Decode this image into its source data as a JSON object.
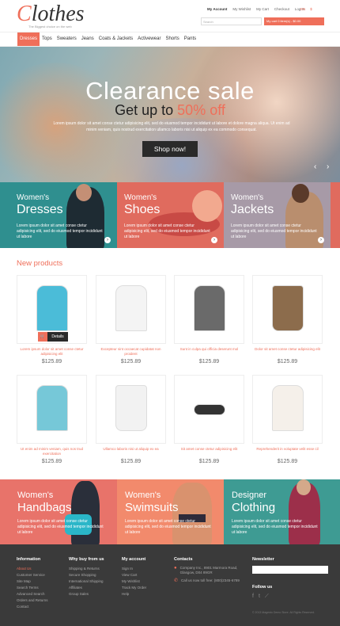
{
  "header": {
    "logo_text": "Clothes",
    "tagline": "The Biggest choice on the web",
    "top_links": [
      "My Account",
      "My Wishlist",
      "My Cart",
      "Checkout",
      "Log In"
    ],
    "lang": "EN",
    "currency": "$",
    "search_placeholder": "Search",
    "cart_label": "My cart  0 item(s) - $0.00"
  },
  "nav": [
    "Dresses",
    "Tops",
    "Sweaters",
    "Jeans",
    "Coats & Jackets",
    "Activewear",
    "Shorts",
    "Pants"
  ],
  "hero": {
    "title": "Clearance sale",
    "subtitle_prefix": "Get up to ",
    "subtitle_pct": "50% off",
    "text": "Lorem ipsum dolor sit amet conse ctetur adipisicing elit, sed do eiusmod tempor incididunt ut labore et dolore magna aliqua. Ut enim ad minim veniam, quis nostrud exercitation ullamco laboris nisi ut aliquip ex ea commodo consequat.",
    "button": "Shop now!",
    "prev": "‹",
    "next": "›"
  },
  "promos": [
    {
      "small": "Women's",
      "big": "Dresses",
      "text": "Lorem ipsum dolor sit amet conse ctetur adipisicing elit, sed do eiusmod tempor incididunt ut labore",
      "color": "#2f8f8f"
    },
    {
      "small": "Women's",
      "big": "Shoes",
      "text": "Lorem ipsum dolor sit amet conse ctetur adipisicing elit, sed do eiusmod tempor incididunt ut labore",
      "color": "#e06b5e"
    },
    {
      "small": "Women's",
      "big": "Jackets",
      "text": "Lorem ipsum dolor sit amet conse ctetur adipisicing elit, sed do eiusmod tempor incididunt ut labore",
      "color": "#a79aa7"
    }
  ],
  "new_products": {
    "heading": "New products",
    "details_label": "Details",
    "items": [
      {
        "name": "Lorem ipsum dolor sit amet conse ctetur adipisicing elit",
        "price": "$125.89",
        "icon": "shirt-icon",
        "color": "#4bbcd8"
      },
      {
        "name": "Excepteur sint occaecat cupidatat non proident",
        "price": "$125.89",
        "icon": "jacket-icon",
        "color": "#f4f4f4"
      },
      {
        "name": "Sunt in culpa qui officia deserunt mol",
        "price": "$125.89",
        "icon": "plaid-shirt-icon",
        "color": "#6a6a6a"
      },
      {
        "name": "Dolor sit amet conse ctetur adipisicing elit",
        "price": "$125.89",
        "icon": "tote-bag-icon",
        "color": "#8c6c4c"
      },
      {
        "name": "Ut enim ad minim veniam, quis nos trud exercitation",
        "price": "$125.89",
        "icon": "sweater-icon",
        "color": "#76c8d8"
      },
      {
        "name": "Ullamco laboris nisi ut aliquip ex ea",
        "price": "$125.89",
        "icon": "handbag-icon",
        "color": "#f2f2f2"
      },
      {
        "name": "Sit amet conse ctetur adipisicing elit",
        "price": "$125.89",
        "icon": "sunglasses-icon",
        "color": "#333333"
      },
      {
        "name": "Reprehenderit in voluptate velit esse cil",
        "price": "$125.89",
        "icon": "knit-sweater-icon",
        "color": "#f5f0ea"
      }
    ]
  },
  "banners": [
    {
      "small": "Women's",
      "big": "Handbags",
      "text": "Lorem ipsum dolor sit amet conse ctetur adipisicing elit, sed do eiusmod tempor incididunt ut labore",
      "color": "#e8736a"
    },
    {
      "small": "Women's",
      "big": "Swimsuits",
      "text": "Lorem ipsum dolor sit amet conse ctetur adipisicing elit, sed do eiusmod tempor incididunt ut labore",
      "color": "#f28a6c"
    },
    {
      "small": "Designer",
      "big": "Clothing",
      "text": "Lorem ipsum dolor sit amet conse ctetur adipisicing elit, sed do eiusmod tempor incididunt ut labore",
      "color": "#3e9b93"
    }
  ],
  "footer": {
    "information": {
      "title": "Information",
      "items": [
        "About Us",
        "Customer Service",
        "Site Map",
        "Search Terms",
        "Advanced Search",
        "Orders and Returns",
        "Contact"
      ]
    },
    "why": {
      "title": "Why buy from us",
      "items": [
        "Shipping & Returns",
        "Secure Shopping",
        "International Shipping",
        "Affiliates",
        "Group Sales"
      ]
    },
    "account": {
      "title": "My account",
      "items": [
        "Sign In",
        "View Cart",
        "My Wishlist",
        "Track My Order",
        "Help"
      ]
    },
    "contacts": {
      "title": "Contacts",
      "address": "Company Inc., 8901 Marmora Road, Glasgow, D04 89GR",
      "phone": "Call us now toll free: (800)2345-6789"
    },
    "newsletter": {
      "title": "Newsletter"
    },
    "follow": {
      "title": "Follow us",
      "icons": [
        "facebook-icon",
        "twitter-icon",
        "rss-icon"
      ]
    },
    "copyright": "© 2013 Magento Demo Store. All Rights Reserved."
  }
}
